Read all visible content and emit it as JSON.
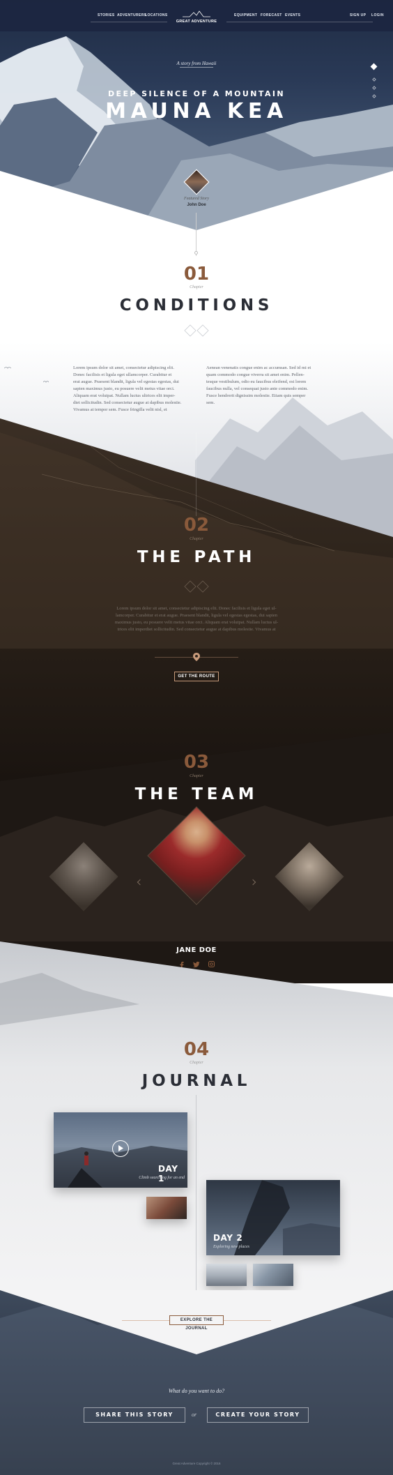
{
  "nav": {
    "left": [
      "STORIES",
      "ADVENTURERS",
      "LOCATIONS"
    ],
    "logo": "GREAT ADVENTURE",
    "right": [
      "EQUIPMENT",
      "FORECAST",
      "EVENTS"
    ],
    "account": [
      "SIGN UP",
      "LOGIN"
    ]
  },
  "hero": {
    "story_prefix": "A story from",
    "story_place": "Hawaii",
    "subtitle": "DEEP SILENCE OF A MOUNTAIN",
    "title": "MAUNA KEA",
    "featured_label": "Featured Story",
    "featured_name": "John Doe"
  },
  "chapters": [
    {
      "num": "01",
      "label": "Chapter",
      "title": "CONDITIONS"
    },
    {
      "num": "02",
      "label": "Chapter",
      "title": "THE PATH"
    },
    {
      "num": "03",
      "label": "Chapter",
      "title": "THE TEAM"
    },
    {
      "num": "04",
      "label": "Chapter",
      "title": "JOURNAL"
    }
  ],
  "conditions": {
    "col1": [
      "Lorem ipsum dolor sit amet, consectetur adipiscing elit.",
      "Donec facilisis et ligula eget ullamcorper. Curabitur et",
      "erat augue. Praesent blandit, ligula vel egestas egestas, dui",
      "sapien maximus justo, eu posuere velit metus vitae orci.",
      "Aliquam erat volutpat. Nullam luctus ultrices elit imper-",
      "diet sollicitudin. Sed consectetur augue at dapibus molestie.",
      "Vivamus at tempor sem. Fusce fringilla velit nisl, et"
    ],
    "col2": [
      "Aenean venenatis congue enim ac accumsan. Sed id mi et",
      "quam commodo congue viverra sit amet enim. Pellen-",
      "tesque vestibulum, odio eu faucibus eleifend, est lorem",
      "faucibus nulla, vel consequat justo ante commodo enim.",
      "Fusce hendrerit dignissim molestie. Etiam quis semper",
      "sem."
    ]
  },
  "path": {
    "lines": [
      "Lorem ipsum dolor sit amet, consectetur adipiscing elit. Donec facilisis et ligula eget ul-",
      "lamcorper. Curabitur et erat augue. Praesent blandit, ligula vel egestas egestas, dui sapien",
      "maximus justo, eu posuere velit metus vitae orci. Aliquam erat volutpat. Nullam luctus ul-",
      "trices elit imperdiet sollicitudin. Sed consectetur augue at dapibus molestie. Vivamus at"
    ],
    "button": "GET THE ROUTE"
  },
  "team": {
    "name": "JANE DOE"
  },
  "journal": {
    "day1_title": "DAY 1",
    "day1_sub": "Climb searching for an end",
    "day2_title": "DAY 2",
    "day2_sub": "Exploring new places",
    "button": "EXPLORE THE JOURNAL"
  },
  "footer": {
    "question": "What do you want to do?",
    "share": "SHARE THIS STORY",
    "or": "or",
    "create": "CREATE YOUR STORY",
    "copyright": "Great Adventure Copyright © 2016"
  },
  "colors": {
    "accent": "#8a5a3b",
    "dark": "#1a1410",
    "navy": "#1f2c44"
  }
}
